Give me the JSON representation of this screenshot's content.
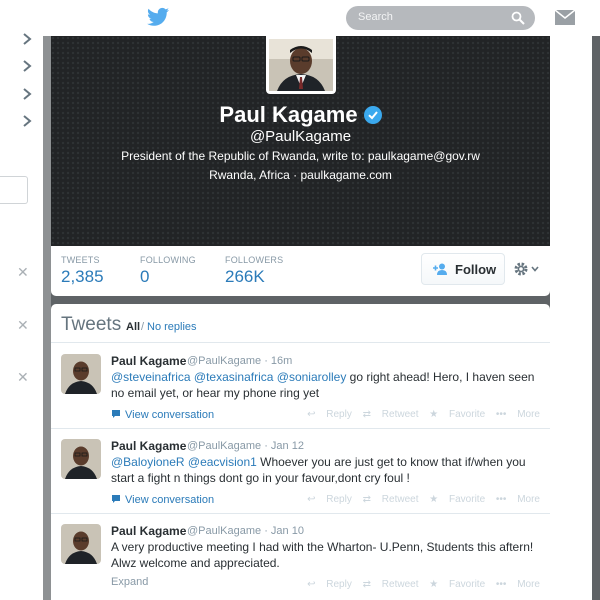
{
  "topbar": {
    "search_placeholder": "Search"
  },
  "profile": {
    "name": "Paul Kagame",
    "handle": "@PaulKagame",
    "bio": "President of the Republic of Rwanda, write to: paulkagame@gov.rw",
    "location": "Rwanda, Africa",
    "separator": "·",
    "website": "paulkagame.com"
  },
  "stats": {
    "tweets_label": "TWEETS",
    "tweets_value": "2,385",
    "following_label": "FOLLOWING",
    "following_value": "0",
    "followers_label": "FOLLOWERS",
    "followers_value": "266K",
    "follow_label": "Follow"
  },
  "timeline": {
    "title": "Tweets",
    "filter_all": "All",
    "filter_sep": "/",
    "filter_noreplies": "No replies"
  },
  "tweets": [
    {
      "name": "Paul Kagame",
      "meta": "@PaulKagame · 16m",
      "m1": "@steveinafrica",
      "m2": "@texasinafrica",
      "m3": "@soniarolley",
      "text": " go right ahead! Hero, I haven seen no email yet, or hear my phone ring yet",
      "footer": "View conversation",
      "reply": "Reply",
      "retweet": "Retweet",
      "favorite": "Favorite",
      "more": "More"
    },
    {
      "name": "Paul Kagame",
      "meta": "@PaulKagame · Jan 12",
      "m1": "@BaloyioneR",
      "m2": "@eacvision1",
      "text": " Whoever you are just get to know that if/when you start a fight n things dont go in your favour,dont cry foul !",
      "footer": "View conversation",
      "reply": "Reply",
      "retweet": "Retweet",
      "favorite": "Favorite",
      "more": "More"
    },
    {
      "name": "Paul Kagame",
      "meta": "@PaulKagame · Jan 10",
      "text": "A very productive meeting I had with the Wharton- U.Penn, Students this aftern! Alwz welcome and appreciated.",
      "footer": "Expand",
      "reply": "Reply",
      "retweet": "Retweet",
      "favorite": "Favorite",
      "more": "More"
    }
  ],
  "colors": {
    "link": "#2b7bb9",
    "verified": "#3ba9ee",
    "header_bg": "#222426"
  }
}
